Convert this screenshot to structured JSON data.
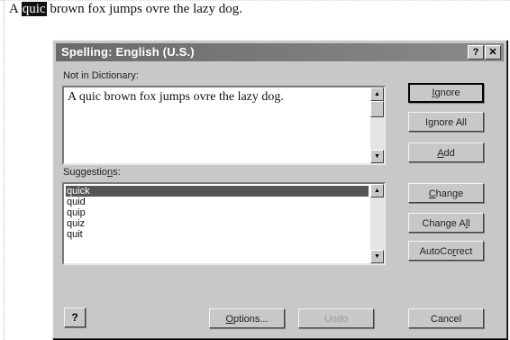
{
  "document": {
    "selected_word": "quic",
    "rest_of_line": " brown fox jumps ovre the lazy dog."
  },
  "dialog": {
    "title": "Spelling: English (U.S.)",
    "help_button": "?",
    "close_button": "✕",
    "not_in_dictionary_label_pre": "Not in Dictionary",
    "not_in_dictionary_label_post": ":",
    "sentence": "A quic brown fox jumps ovre the lazy dog.",
    "suggestions_label_pre": "Suggestio",
    "suggestions_label_u": "n",
    "suggestions_label_post": "s:",
    "suggestions": [
      "quick",
      "quid",
      "quip",
      "quiz",
      "quit"
    ],
    "buttons": {
      "ignore_u": "I",
      "ignore_rest": "gnore",
      "ignore_all_pre": "I",
      "ignore_all_u": "g",
      "ignore_all_rest": "nore All",
      "add_u": "A",
      "add_rest": "dd",
      "change_u": "C",
      "change_rest": "hange",
      "change_all_pre": "Change A",
      "change_all_u": "l",
      "change_all_rest": "l",
      "autocorrect_pre": "AutoCo",
      "autocorrect_u": "r",
      "autocorrect_rest": "rect",
      "options_u": "O",
      "options_rest": "ptions...",
      "undo": "Undo",
      "cancel": "Cancel"
    },
    "help_icon_glyph": "?"
  }
}
